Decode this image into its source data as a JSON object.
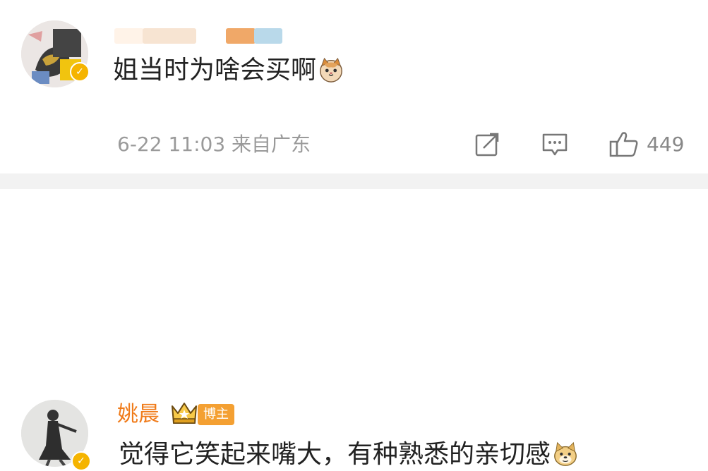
{
  "comment1": {
    "text": "姐当时为啥会买啊",
    "emoji": "cat-emoji",
    "meta": "6-22 11:03 来自广东",
    "like_count": "449"
  },
  "comment2": {
    "name": "姚晨",
    "badge": "博主",
    "text": "觉得它笑起来嘴大，有种熟悉的亲切感",
    "emoji": "doge-emoji"
  },
  "colors": {
    "accent_name": "#f07b1a",
    "badge_bg": "#f4a032",
    "verified": "#f5b400"
  },
  "icons": [
    "share-icon",
    "comment-icon",
    "like-icon",
    "crown-icon",
    "verified-icon"
  ]
}
